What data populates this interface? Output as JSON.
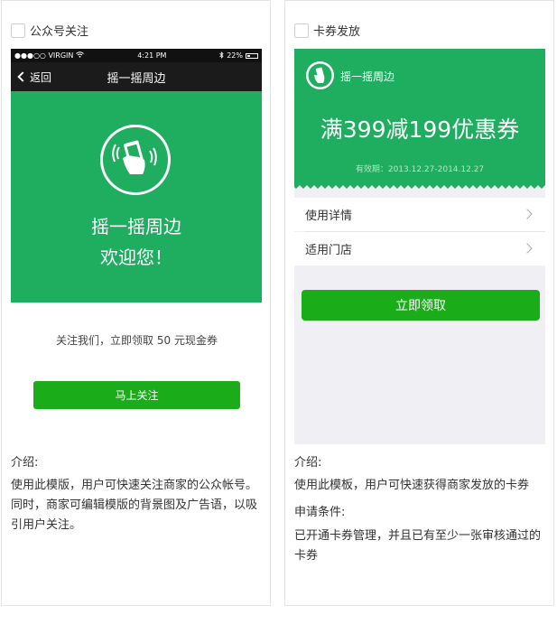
{
  "left_card": {
    "title": "公众号关注",
    "phone": {
      "status": {
        "carrier": "●●●○○ VIRGIN",
        "time": "4:21 PM",
        "battery": "22%"
      },
      "back_label": "返回",
      "nav_title": "摇一摇周边",
      "main_title": "摇一摇周边",
      "subtitle": "欢迎您！",
      "bg_color": "#1fad60"
    },
    "follow_tip": "关注我们，立即领取 50 元现金券",
    "follow_button": "马上关注",
    "intro": {
      "heading": "介绍:",
      "body": "使用此模版，用户可快速关注商家的公众帐号。同时，商家可编辑模版的背景图及广告语，以吸引用户关注。"
    }
  },
  "right_card": {
    "title": "卡券发放",
    "coupon": {
      "brand": "摇一摇周边",
      "title": "满399减199优惠券",
      "validity": "有效期：2013.12.27-2014.12.27"
    },
    "rows": [
      {
        "label": "使用详情"
      },
      {
        "label": "适用门店"
      }
    ],
    "claim_button": "立即领取",
    "intro": {
      "heading": "介绍:",
      "body": "使用此模板，用户可快速获得商家发放的卡券",
      "condition_heading": "申请条件:",
      "condition_body": "已开通卡券管理，并且已有至少一张审核通过的卡券"
    }
  },
  "colors": {
    "accent_green": "#1aad19",
    "banner_green": "#1fad60"
  },
  "icons": [
    "checkbox",
    "back-chevron-icon",
    "shake-phone-icon",
    "chevron-right-icon",
    "brand-logo-icon",
    "wifi-icon",
    "bluetooth-icon",
    "battery-icon"
  ]
}
